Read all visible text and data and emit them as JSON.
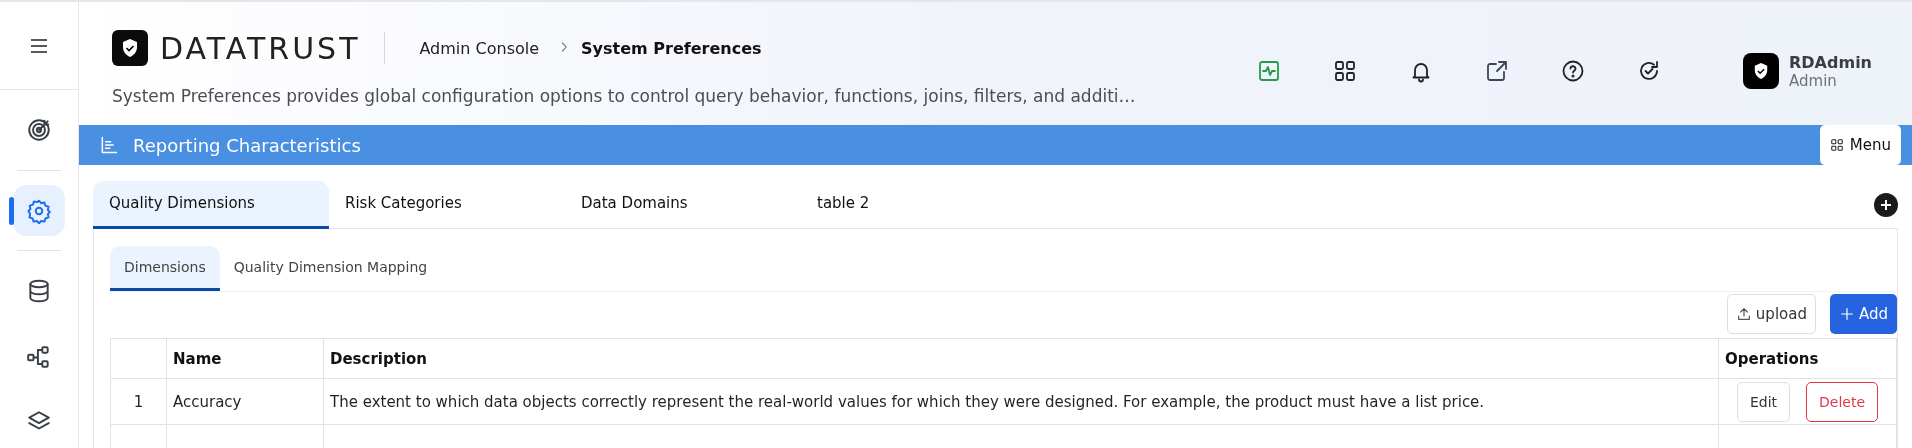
{
  "sidebar": {
    "items": [
      {
        "kind": "target",
        "selected": false
      },
      {
        "kind": "gear",
        "selected": true
      },
      {
        "kind": "database",
        "selected": false
      },
      {
        "kind": "hierarchy",
        "selected": false
      },
      {
        "kind": "layers",
        "selected": false
      }
    ]
  },
  "header": {
    "logo": "DATATRUST",
    "breadcrumb": [
      "Admin Console",
      "System Preferences"
    ],
    "description": "System Preferences provides global configuration options to control query behavior, functions, joins, filters, and additi…",
    "toolbar": [
      {
        "kind": "activity"
      },
      {
        "kind": "apps"
      },
      {
        "kind": "bell"
      },
      {
        "kind": "external"
      },
      {
        "kind": "help"
      },
      {
        "kind": "refresh-check"
      }
    ],
    "user": {
      "name": "RDAdmin",
      "role": "Admin"
    }
  },
  "section": {
    "title": "Reporting Characteristics",
    "menu_button": "Menu"
  },
  "tabs": [
    {
      "label": "Quality Dimensions",
      "selected": true
    },
    {
      "label": "Risk Categories",
      "selected": false
    },
    {
      "label": "Data Domains",
      "selected": false
    },
    {
      "label": "table 2",
      "selected": false
    }
  ],
  "subtabs": [
    {
      "label": "Dimensions",
      "selected": true
    },
    {
      "label": "Quality Dimension Mapping",
      "selected": false
    }
  ],
  "actions": {
    "upload": "upload",
    "add": "Add"
  },
  "table": {
    "columns": [
      "Name",
      "Description",
      "Operations"
    ],
    "rows": [
      {
        "index": "1",
        "name": "Accuracy",
        "description": "The extent to which data objects correctly represent the real-world values for which they were designed. For example, the product must have a list price.",
        "operations": [
          "Edit",
          "Delete"
        ]
      }
    ]
  }
}
